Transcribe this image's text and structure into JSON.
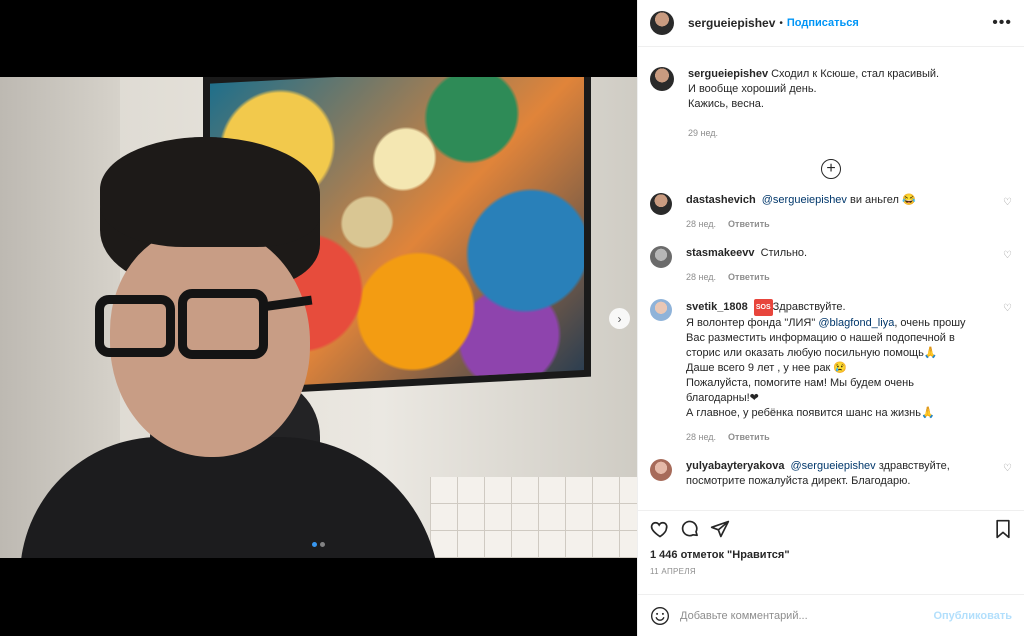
{
  "post": {
    "username": "sergueiepishev",
    "separator": "•",
    "follow_label": "Подписаться",
    "more_icon": "more-horizontal-icon"
  },
  "caption": {
    "username": "sergueiepishev",
    "lines": [
      "Сходил к Ксюше, стал красивый.",
      "И вообще хороший день.",
      "Кажись, весна."
    ],
    "time": "29 нед."
  },
  "comments": [
    {
      "username": "dastashevich",
      "mention": "@sergueiepishev",
      "text": "ви аньгел 😂",
      "time": "28 нед.",
      "reply": "Ответить"
    },
    {
      "username": "stasmakeevv",
      "text": "Стильно.",
      "time": "28 нед.",
      "reply": "Ответить"
    },
    {
      "username": "svetik_1808",
      "badge": "SOS",
      "text_1": "Здравствуйте.",
      "text_2": "Я волонтер фонда \"ЛИЯ\" ",
      "mention": "@blagfond_liya",
      "text_3": ", очень прошу Вас разместить информацию о нашей подопечной в сторис или оказать любую посильную помощь🙏",
      "text_4": "Даше всего 9 лет , у нее рак 😢",
      "text_5": "Пожалуйста, помогите нам! Мы будем очень благодарны!❤",
      "text_6": "А главное, у ребёнка появится шанс на жизнь🙏",
      "time": "28 нед.",
      "reply": "Ответить"
    },
    {
      "username": "yulyabayteryakova",
      "mention": "@sergueiepishev",
      "text": "здравствуйте, посмотрите пожалуйста директ. Благодарю."
    }
  ],
  "actions": {
    "likes": "1 446 отметок \"Нравится\"",
    "date": "11 АПРЕЛЯ"
  },
  "add_comment": {
    "placeholder": "Добавьте комментарий...",
    "publish": "Опубликовать"
  },
  "carousel": {
    "total_slides": 2,
    "current_slide": 1
  }
}
